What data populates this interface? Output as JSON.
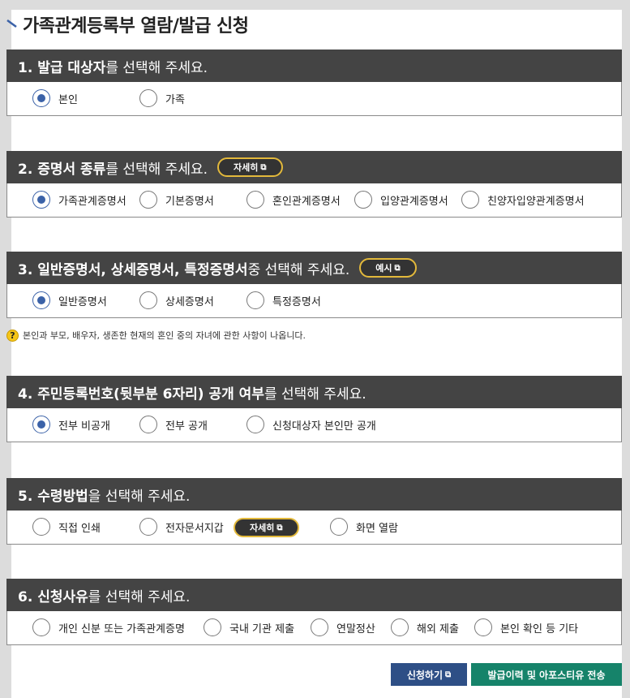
{
  "page": {
    "title": "가족관계등록부 열람/발급 신청"
  },
  "sections": [
    {
      "head_bold": "1. 발급 대상자",
      "head_rest": "를 선택해 주세요.",
      "options": [
        {
          "label": "본인",
          "checked": true
        },
        {
          "label": "가족",
          "checked": false
        }
      ]
    },
    {
      "head_bold": "2. 증명서 종류",
      "head_rest": "를 선택해 주세요.",
      "pill": "자세히",
      "options": [
        {
          "label": "가족관계증명서",
          "checked": true
        },
        {
          "label": "기본증명서",
          "checked": false
        },
        {
          "label": "혼인관계증명서",
          "checked": false
        },
        {
          "label": "입양관계증명서",
          "checked": false
        },
        {
          "label": "친양자입양관계증명서",
          "checked": false
        }
      ]
    },
    {
      "head_bold": "3. 일반증명서, 상세증명서, 특정증명서",
      "head_rest": " 중 선택해 주세요.",
      "pill": "예시",
      "options": [
        {
          "label": "일반증명서",
          "checked": true
        },
        {
          "label": "상세증명서",
          "checked": false
        },
        {
          "label": "특정증명서",
          "checked": false
        }
      ],
      "note": "본인과 부모, 배우자, 생존한 현재의 혼인 중의 자녀에 관한 사항이 나옵니다."
    },
    {
      "head_bold": "4. 주민등록번호(뒷부분 6자리) 공개 여부",
      "head_rest": "를 선택해 주세요.",
      "options": [
        {
          "label": "전부 비공개",
          "checked": true
        },
        {
          "label": "전부 공개",
          "checked": false
        },
        {
          "label": "신청대상자 본인만 공개",
          "checked": false
        }
      ]
    },
    {
      "head_bold": "5. 수령방법",
      "head_rest": "을 선택해 주세요.",
      "inline_pill": "자세히",
      "options": [
        {
          "label": "직접 인쇄",
          "checked": false
        },
        {
          "label": "전자문서지갑",
          "checked": false
        },
        {
          "label": "화면 열람",
          "checked": false
        }
      ]
    },
    {
      "head_bold": "6. 신청사유",
      "head_rest": "를 선택해 주세요.",
      "options": [
        {
          "label": "개인 신분 또는 가족관계증명",
          "checked": false
        },
        {
          "label": "국내 기관 제출",
          "checked": false
        },
        {
          "label": "연말정산",
          "checked": false
        },
        {
          "label": "해외 제출",
          "checked": false
        },
        {
          "label": "본인 확인 등 기타",
          "checked": false
        }
      ]
    }
  ],
  "buttons": {
    "apply": "신청하기",
    "history": "발급이력 및 아포스티유 전송"
  },
  "colors": {
    "header_bg": "#444444",
    "radio_checked": "#3b62a8",
    "pill_border": "#e3b93b",
    "apply_button": "#2e4f86",
    "history_button": "#16836a"
  }
}
